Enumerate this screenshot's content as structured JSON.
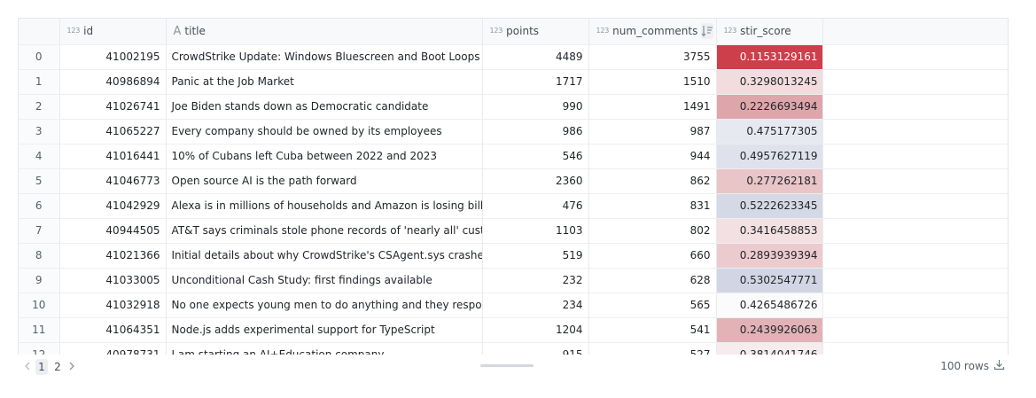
{
  "columns": [
    {
      "key": "index",
      "label": "",
      "type_icon": ""
    },
    {
      "key": "id",
      "label": "id",
      "type_icon": "123"
    },
    {
      "key": "title",
      "label": "title",
      "type_icon": "A"
    },
    {
      "key": "points",
      "label": "points",
      "type_icon": "123"
    },
    {
      "key": "num_comments",
      "label": "num_comments",
      "type_icon": "123",
      "sorted": "descending"
    },
    {
      "key": "stir_score",
      "label": "stir_score",
      "type_icon": "123"
    }
  ],
  "rows": [
    {
      "index": "0",
      "id": "41002195",
      "title": "CrowdStrike Update: Windows Bluescreen and Boot Loops",
      "points": "4489",
      "num_comments": "3755",
      "stir_score": "0.1153129161",
      "stir_color": "#cd3f4a",
      "stir_text_color": "#ffffff"
    },
    {
      "index": "1",
      "id": "40986894",
      "title": "Panic at the Job Market",
      "points": "1717",
      "num_comments": "1510",
      "stir_score": "0.3298013245",
      "stir_color": "#f1dcde",
      "stir_text_color": "#1f2328"
    },
    {
      "index": "2",
      "id": "41026741",
      "title": "Joe Biden stands down as Democratic candidate",
      "points": "990",
      "num_comments": "1491",
      "stir_score": "0.2226693494",
      "stir_color": "#dea6aa",
      "stir_text_color": "#1f2328"
    },
    {
      "index": "3",
      "id": "41065227",
      "title": "Every company should be owned by its employees",
      "points": "986",
      "num_comments": "987",
      "stir_score": "0.475177305",
      "stir_color": "#e7e9f1",
      "stir_text_color": "#1f2328"
    },
    {
      "index": "4",
      "id": "41016441",
      "title": "10% of Cubans left Cuba between 2022 and 2023",
      "points": "546",
      "num_comments": "944",
      "stir_score": "0.4957627119",
      "stir_color": "#dfe2ec",
      "stir_text_color": "#1f2328"
    },
    {
      "index": "5",
      "id": "41046773",
      "title": "Open source AI is the path forward",
      "points": "2360",
      "num_comments": "862",
      "stir_score": "0.277262181",
      "stir_color": "#e9c5c8",
      "stir_text_color": "#1f2328"
    },
    {
      "index": "6",
      "id": "41042929",
      "title": "Alexa is in millions of households and Amazon is losing billions",
      "points": "476",
      "num_comments": "831",
      "stir_score": "0.5222623345",
      "stir_color": "#d5d9e6",
      "stir_text_color": "#1f2328"
    },
    {
      "index": "7",
      "id": "40944505",
      "title": "AT&T says criminals stole phone records of 'nearly all' customers",
      "points": "1103",
      "num_comments": "802",
      "stir_score": "0.3416458853",
      "stir_color": "#f2e0e2",
      "stir_text_color": "#1f2328"
    },
    {
      "index": "8",
      "id": "41021366",
      "title": "Initial details about why CrowdStrike's CSAgent.sys crashed",
      "points": "519",
      "num_comments": "660",
      "stir_score": "0.2893939394",
      "stir_color": "#eccbce",
      "stir_text_color": "#1f2328"
    },
    {
      "index": "9",
      "id": "41033005",
      "title": "Unconditional Cash Study: first findings available",
      "points": "232",
      "num_comments": "628",
      "stir_score": "0.5302547771",
      "stir_color": "#d2d6e4",
      "stir_text_color": "#1f2328"
    },
    {
      "index": "10",
      "id": "41032918",
      "title": "No one expects young men to do anything and they respond by do",
      "points": "234",
      "num_comments": "565",
      "stir_score": "0.4265486726",
      "stir_color": "#fbfbfc",
      "stir_text_color": "#1f2328"
    },
    {
      "index": "11",
      "id": "41064351",
      "title": "Node.js adds experimental support for TypeScript",
      "points": "1204",
      "num_comments": "541",
      "stir_score": "0.2439926063",
      "stir_color": "#e2b2b6",
      "stir_text_color": "#1f2328"
    },
    {
      "index": "12",
      "id": "40978731",
      "title": "I am starting an AI+Education company",
      "points": "915",
      "num_comments": "527",
      "stir_score": "0.3814041746",
      "stir_color": "#f6eced",
      "stir_text_color": "#1f2328"
    }
  ],
  "pagination": {
    "pages": [
      "1",
      "2"
    ],
    "current": "1"
  },
  "row_count": "100 rows",
  "icons": {
    "sort": "sort-descending-icon",
    "download": "download-icon",
    "prev": "chevron-left-icon",
    "next": "chevron-right-icon"
  }
}
